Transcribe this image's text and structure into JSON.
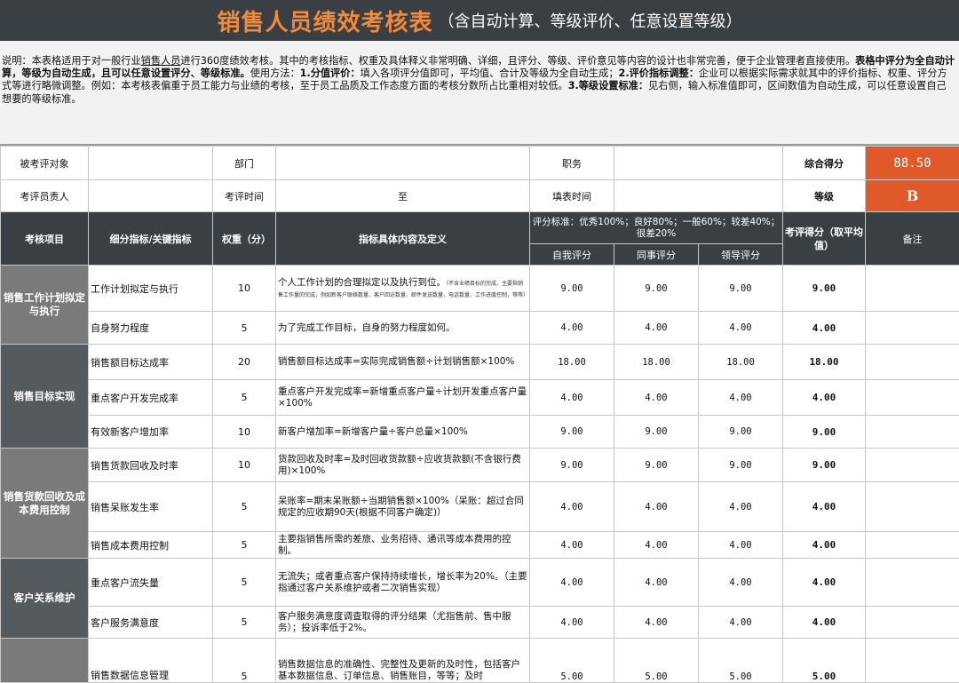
{
  "title": {
    "main": "销售人员绩效考核表",
    "sub": "（含自动计算、等级评价、任意设置等级）"
  },
  "description": {
    "p1": "说明：本表格适用于对一般行业",
    "link": "销售人员",
    "p2": "进行360度绩效考核。其中的考核指标、权重及具体释义非常明确、详细，且评分、等级、评价意见等内容的设计也非常完善，便于企业管理者直接使用。",
    "b1": "表格中评分为全自动计算，等级为自动生成，且可以任意设置评分、等级标准。",
    "p3": "使用方法：",
    "b2": "1.分值评价：",
    "p4": "填入各项评分值即可，平均值、合计及等级为全自动生成；",
    "b3": "2.评价指标调整：",
    "p5": "企业可以根据实际需求就其中的评价指标、权重、评分方式等进行略微调整。例如：本考核表偏重于员工能力与业绩的考核，至于员工品质及工作态度方面的考核分数所占比重相对较低。",
    "b4": "3.等级设置标准：",
    "p6": "见右侧，输入标准值即可，区间数值为自动生成，可以任意设置自己想要的等级标准。"
  },
  "info": {
    "assessee_label": "被考评对象",
    "assessee_value": "",
    "dept_label": "部门",
    "dept_value": "",
    "position_label": "职务",
    "position_value": "",
    "total_label": "综合得分",
    "total_value": "88.50",
    "assessor_label": "考评员责人",
    "assessor_value": "",
    "time_label": "考评时间",
    "time_value": "至",
    "fill_label": "填表时间",
    "fill_value": "",
    "grade_label": "等级",
    "grade_value": "B"
  },
  "headers": {
    "item": "考核项目",
    "sub": "细分指标/关键指标",
    "weight": "权重（分）",
    "content": "指标具体内容及定义",
    "standard": "评分标准：优秀100%；良好80%；一般60%；较差40%；很差20%",
    "self": "自我评分",
    "peer": "同事评分",
    "leader": "领导评分",
    "score": "考评得分（取平均值）",
    "remark": "备注"
  },
  "categories": [
    {
      "name": "销售工作计划拟定与执行"
    },
    {
      "name": "销售目标实现"
    },
    {
      "name": "销售货款回收及成本费用控制"
    },
    {
      "name": "客户关系维护"
    }
  ],
  "rows": [
    {
      "sub": "工作计划拟定与执行",
      "weight": "10",
      "content": "个人工作计划的合理拟定以及执行到位。",
      "small": "（不含业绩目标的完成，主要指销售工作量的完成，例如新客户联络数量、客户回访数量、邮件发送数量、电话数量、工作进度控制，等等）",
      "self": "9.00",
      "peer": "9.00",
      "leader": "9.00",
      "score": "9.00"
    },
    {
      "sub": "自身努力程度",
      "weight": "5",
      "content": "为了完成工作目标，自身的努力程度如何。",
      "self": "4.00",
      "peer": "4.00",
      "leader": "4.00",
      "score": "4.00"
    },
    {
      "sub": "销售额目标达成率",
      "weight": "20",
      "content": "销售额目标达成率=实际完成销售额÷计划销售额×100%",
      "self": "18.00",
      "peer": "18.00",
      "leader": "18.00",
      "score": "18.00"
    },
    {
      "sub": "重点客户开发完成率",
      "weight": "5",
      "content": "重点客户开发完成率=新增重点客户量÷计划开发重点客户量×100%",
      "self": "4.00",
      "peer": "4.00",
      "leader": "4.00",
      "score": "4.00"
    },
    {
      "sub": "有效新客户增加率",
      "weight": "10",
      "content": "新客户增加率=新增客户量÷客户总量×100%",
      "self": "9.00",
      "peer": "9.00",
      "leader": "9.00",
      "score": "9.00"
    },
    {
      "sub": "销售货款回收及时率",
      "weight": "10",
      "content": "货款回收及时率=及时回收货款额÷应收货款额(不含银行费用)×100%",
      "self": "9.00",
      "peer": "9.00",
      "leader": "9.00",
      "score": "9.00"
    },
    {
      "sub": "销售呆账发生率",
      "weight": "5",
      "content": "呆账率=期末呆账额÷当期销售额×100%（呆账：超过合同规定的应收期90天(根据不同客户确定)）",
      "self": "4.00",
      "peer": "4.00",
      "leader": "4.00",
      "score": "4.00"
    },
    {
      "sub": "销售成本费用控制",
      "weight": "5",
      "content": "主要指销售所需的差旅、业务招待、通讯等成本费用的控制。",
      "self": "4.00",
      "peer": "4.00",
      "leader": "4.00",
      "score": "4.00"
    },
    {
      "sub": "重点客户流失量",
      "weight": "5",
      "content": "无流失；或者重点客户保持持续增长，增长率为20%。（主要指通过客户关系维护或者二次销售实现）",
      "self": "4.00",
      "peer": "4.00",
      "leader": "4.00",
      "score": "4.00"
    },
    {
      "sub": "客户服务满意度",
      "weight": "5",
      "content": "客户服务满意度调查取得的评分结果（尤指售前、售中服务）；投诉率低于2%。",
      "self": "4.00",
      "peer": "4.00",
      "leader": "4.00",
      "score": "4.00"
    },
    {
      "sub": "销售数据信息管理",
      "weight": "5",
      "content": "销售数据信息的准确性、完整性及更新的及时性，包括客户基本数据信息、订单信息、销售账目，等等；及时",
      "self": "5.00",
      "peer": "5.00",
      "leader": "5.00",
      "score": "5.00"
    }
  ]
}
